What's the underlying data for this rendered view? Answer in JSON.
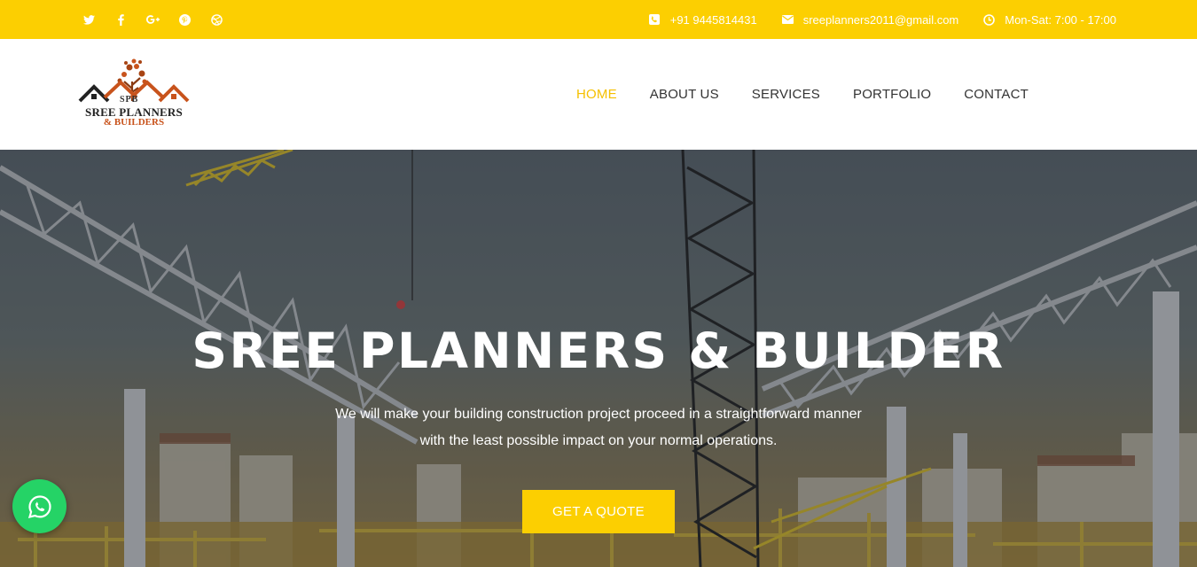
{
  "topbar": {
    "social": [
      {
        "name": "twitter-icon"
      },
      {
        "name": "facebook-icon"
      },
      {
        "name": "google-plus-icon"
      },
      {
        "name": "pinterest-icon"
      },
      {
        "name": "dribbble-icon"
      }
    ],
    "phone": "+91 9445814431",
    "email": "sreeplanners2011@gmail.com",
    "hours": "Mon-Sat: 7:00 - 17:00"
  },
  "logo": {
    "mark": "SPB",
    "name": "SREE PLANNERS",
    "sub": "& BUILDERS"
  },
  "nav": {
    "items": [
      "HOME",
      "ABOUT US",
      "SERVICES",
      "PORTFOLIO",
      "CONTACT"
    ],
    "active": "HOME"
  },
  "hero": {
    "title": "SREE PLANNERS & BUILDER",
    "subtitle_line1": "We will make your building construction project proceed in a straightforward manner",
    "subtitle_line2": "with the least possible impact on your normal operations.",
    "cta": "GET A QUOTE"
  },
  "colors": {
    "accent": "#fccf01",
    "whatsapp": "#25d366",
    "logo_orange": "#c8531c"
  }
}
